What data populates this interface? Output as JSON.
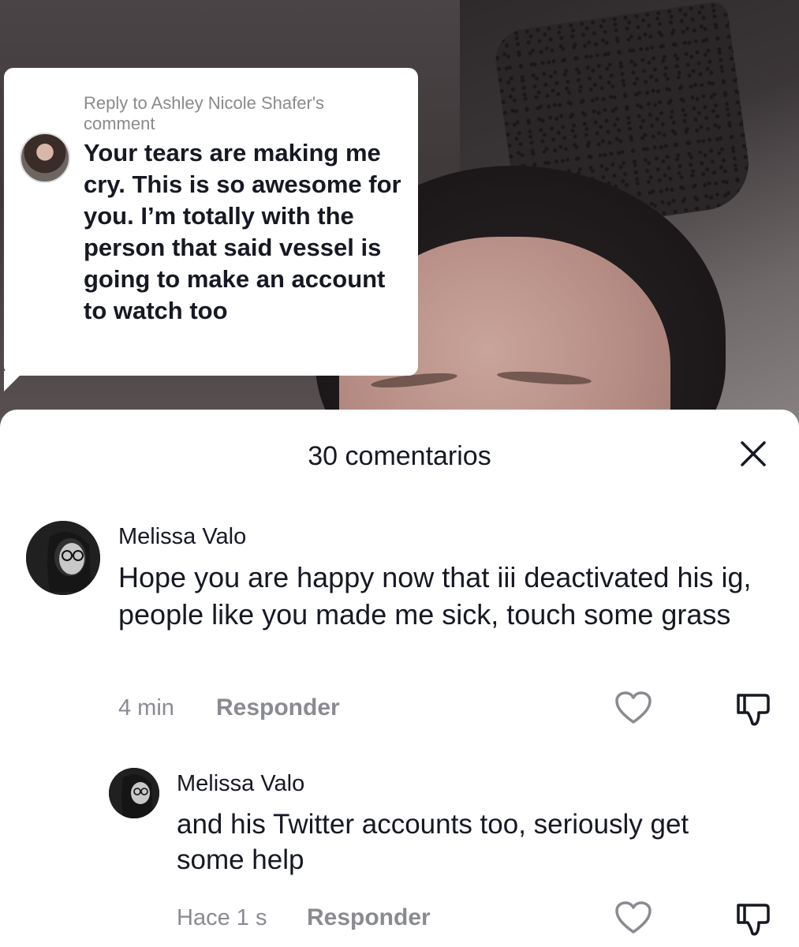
{
  "sticker": {
    "header": "Reply to Ashley Nicole Shafer's comment",
    "text": "Your tears are making me cry. This is so awesome for you. I’m totally with the person that said vessel is going to make an account to watch too"
  },
  "sheet": {
    "title": "30 comentarios",
    "close_icon": "close-icon"
  },
  "comments": [
    {
      "name": "Melissa Valo",
      "text": "Hope you are happy now that iii deactivated his ig, people like you made me sick, touch some grass",
      "time": "4 min",
      "reply_label": "Responder",
      "like_icon": "heart-icon",
      "dislike_icon": "thumbs-down-icon"
    },
    {
      "name": "Melissa Valo",
      "text": "and his Twitter accounts too, seriously get some help",
      "time": "Hace 1 s",
      "reply_label": "Responder",
      "like_icon": "heart-icon",
      "dislike_icon": "thumbs-down-icon"
    }
  ],
  "colors": {
    "text_primary": "#161823",
    "text_secondary": "#8a8b91",
    "sheet_bg": "#ffffff"
  }
}
